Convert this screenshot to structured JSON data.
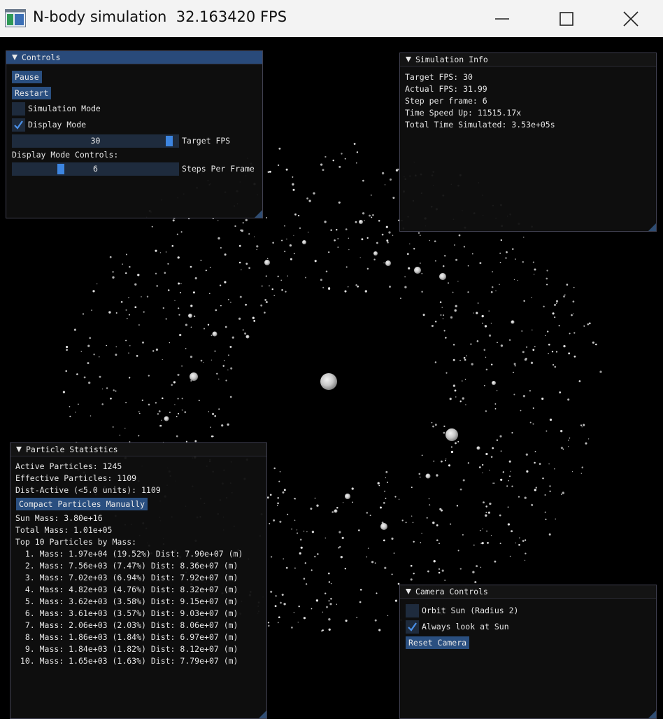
{
  "window": {
    "title": "N-body simulation  32.163420 FPS",
    "icon": "app-window-icon",
    "buttons": [
      "minimize-icon",
      "maximize-icon",
      "close-icon"
    ]
  },
  "controls": {
    "title": "Controls",
    "pause_label": "Pause",
    "restart_label": "Restart",
    "simulation_mode_label": "Simulation Mode",
    "simulation_mode_checked": false,
    "display_mode_label": "Display Mode",
    "display_mode_checked": true,
    "target_fps_value": "30",
    "target_fps_label": "Target FPS",
    "target_fps_fraction": 0.97,
    "display_mode_controls_label": "Display Mode Controls:",
    "steps_value": "6",
    "steps_label": "Steps Per Frame",
    "steps_fraction": 0.28
  },
  "sim_info": {
    "title": "Simulation Info",
    "lines": [
      "Target FPS: 30",
      "Actual FPS: 31.99",
      "Step per frame: 6",
      "Time Speed Up: 11515.17x",
      "Total Time Simulated: 3.53e+05s"
    ]
  },
  "particle_stats": {
    "title": "Particle Statistics",
    "active": "Active Particles: 1245",
    "effective": "Effective Particles: 1109",
    "dist_active": "Dist-Active (<5.0 units): 1109",
    "compact_label": "Compact Particles Manually",
    "sun_mass": "Sun Mass: 3.80e+16",
    "total_mass": "Total Mass: 1.01e+05",
    "top_label": "Top 10 Particles by Mass:",
    "top": [
      "  1. Mass: 1.97e+04 (19.52%) Dist: 7.90e+07 (m)",
      "  2. Mass: 7.56e+03 (7.47%) Dist: 8.36e+07 (m)",
      "  3. Mass: 7.02e+03 (6.94%) Dist: 7.92e+07 (m)",
      "  4. Mass: 4.82e+03 (4.76%) Dist: 8.32e+07 (m)",
      "  5. Mass: 3.62e+03 (3.58%) Dist: 9.15e+07 (m)",
      "  6. Mass: 3.61e+03 (3.57%) Dist: 9.03e+07 (m)",
      "  7. Mass: 2.06e+03 (2.03%) Dist: 8.06e+07 (m)",
      "  8. Mass: 1.86e+03 (1.84%) Dist: 6.97e+07 (m)",
      "  9. Mass: 1.84e+03 (1.82%) Dist: 8.12e+07 (m)",
      " 10. Mass: 1.65e+03 (1.63%) Dist: 7.79e+07 (m)"
    ]
  },
  "camera": {
    "title": "Camera Controls",
    "orbit_label": "Orbit Sun (Radius 2)",
    "orbit_checked": false,
    "look_label": "Always look at Sun",
    "look_checked": true,
    "reset_label": "Reset Camera"
  },
  "colors": {
    "title_bg": "#f3f3f3",
    "panel_bg": "#0f0f0f",
    "header_active": "#294a7a",
    "button": "#2a4f80",
    "frame": "#1e2b3d",
    "slider_grab": "#3d85e0"
  }
}
